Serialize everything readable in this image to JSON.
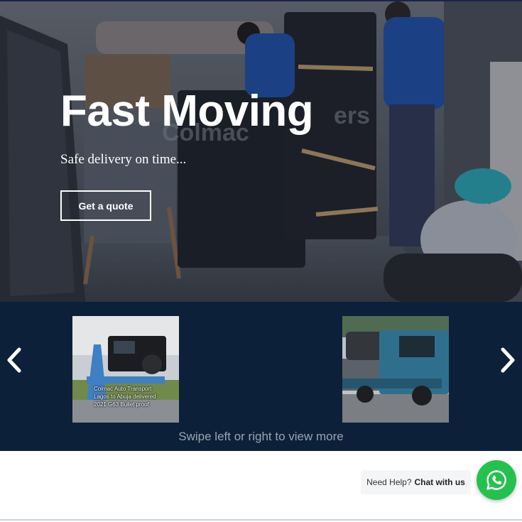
{
  "hero": {
    "title": "Fast Moving",
    "subtitle": "Safe delivery on time...",
    "cta_label": "Get a quote"
  },
  "carousel": {
    "prev_icon": "chevron-left-icon",
    "next_icon": "chevron-right-icon",
    "slides": [
      {
        "caption_lines": [
          "Colmac Auto Transport",
          "Lagos to Abuja delivered",
          "2021 G63 Bullet proof"
        ]
      },
      {
        "caption_lines": []
      }
    ],
    "swipe_hint": "Swipe left or right to view more"
  },
  "help": {
    "prefix": "Need Help?",
    "action": "Chat with us",
    "icon": "whatsapp-icon"
  },
  "colors": {
    "carousel_bg": "#0d2039",
    "whatsapp_green": "#25c14f"
  }
}
